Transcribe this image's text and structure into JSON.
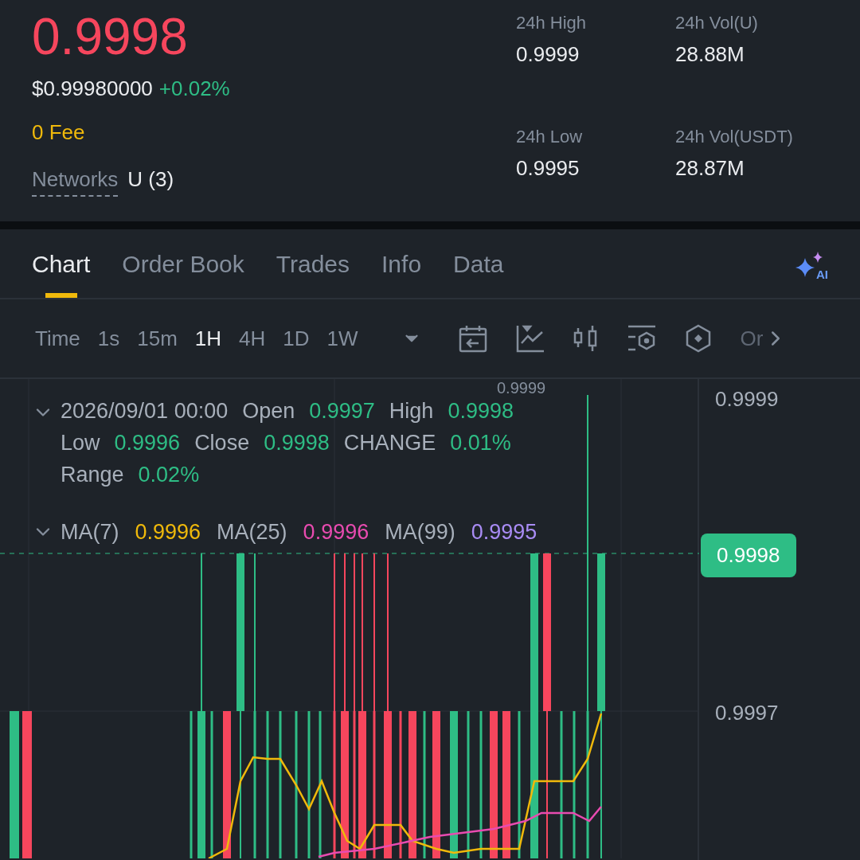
{
  "header": {
    "price": "0.9998",
    "usd_price": "$0.99980000",
    "change": "+0.02%",
    "fee": "0 Fee",
    "networks_label": "Networks",
    "networks_value": "U (3)"
  },
  "stats": [
    {
      "label": "24h High",
      "value": "0.9999"
    },
    {
      "label": "24h Vol(U)",
      "value": "28.88M"
    },
    {
      "label": "24h Low",
      "value": "0.9995"
    },
    {
      "label": "24h Vol(USDT)",
      "value": "28.87M"
    }
  ],
  "tabs": [
    {
      "label": "Chart",
      "selected": true
    },
    {
      "label": "Order Book",
      "selected": false
    },
    {
      "label": "Trades",
      "selected": false
    },
    {
      "label": "Info",
      "selected": false
    },
    {
      "label": "Data",
      "selected": false
    }
  ],
  "intervals": [
    {
      "label": "Time",
      "selected": false
    },
    {
      "label": "1s",
      "selected": false
    },
    {
      "label": "15m",
      "selected": false
    },
    {
      "label": "1H",
      "selected": true
    },
    {
      "label": "4H",
      "selected": false
    },
    {
      "label": "1D",
      "selected": false
    },
    {
      "label": "1W",
      "selected": false
    }
  ],
  "toolbar_more": "Or",
  "ai_label": "AI",
  "legend": {
    "date": "2026/09/01 00:00",
    "fields": [
      {
        "label": "Open",
        "value": "0.9997"
      },
      {
        "label": "High",
        "value": "0.9998"
      },
      {
        "label": "Low",
        "value": "0.9996"
      },
      {
        "label": "Close",
        "value": "0.9998"
      },
      {
        "label": "CHANGE",
        "value": "0.01%"
      },
      {
        "label": "Range",
        "value": "0.02%"
      }
    ]
  },
  "ma": [
    {
      "label": "MA(7)",
      "value": "0.9996",
      "color": "#f0b90b"
    },
    {
      "label": "MA(25)",
      "value": "0.9996",
      "color": "#e84bb0"
    },
    {
      "label": "MA(99)",
      "value": "0.9995",
      "color": "#a98cf5"
    }
  ],
  "axis": {
    "labels": [
      "0.9999",
      "0.9997"
    ],
    "current_price": "0.9998",
    "high_marker": "0.9999"
  }
}
